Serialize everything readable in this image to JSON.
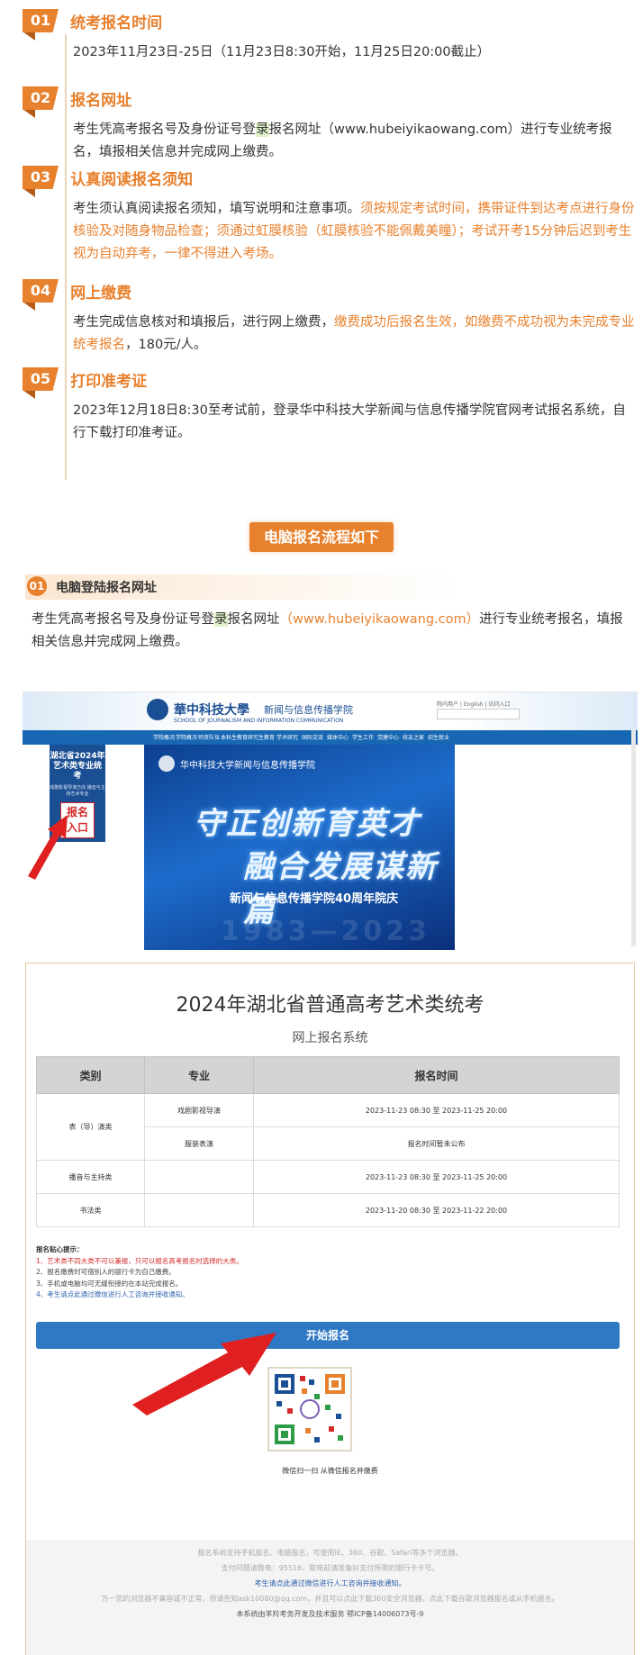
{
  "steps": [
    {
      "num": "01",
      "title": "统考报名时间",
      "body": "2023年11月23日-25日（11月23日8:30开始，11月25日20:00截止）"
    },
    {
      "num": "02",
      "title": "报名网址",
      "body_a": "考生凭高考报名号及身份证号登",
      "body_hl": "录",
      "body_b": "报名网址（www.hubeiyikaowang.com）进行专业统考报名，填报相关信息并完成网上缴费。"
    },
    {
      "num": "03",
      "title": "认真阅读报名须知",
      "body_a": "考生须认真阅读报名须知，填写说明和注意事项。",
      "body_orange": "须按规定考试时间，携带证件到达考点进行身份核验及对随身物品检查；须通过虹膜核验（虹膜核验不能佩戴美瞳）；考试开考15分钟后迟到考生视为自动弃考，一律不得进入考场。"
    },
    {
      "num": "04",
      "title": "网上缴费",
      "body_a": "考生完成信息核对和填报后，进行网上缴费，",
      "body_orange": "缴费成功后报名生效，如缴费不成功视为未完成专业统考报名",
      "body_b": "，180元/人。"
    },
    {
      "num": "05",
      "title": "打印准考证",
      "body": "2023年12月18日8:30至考试前，登录华中科技大学新闻与信息传播学院官网考试报名系统，自行下载打印准考证。"
    }
  ],
  "section_banner": "电脑报名流程如下",
  "substep": {
    "num": "01",
    "title": "电脑登陆报名网址"
  },
  "substep_text": {
    "a": "考生凭高考报名号及身份证号登",
    "hl": "录",
    "b": "报名网址",
    "url": "（www.hubeiyikaowang.com）",
    "c": "进行专业统考报名，填报相关信息并完成网上缴费。"
  },
  "site": {
    "logo": "華中科技大學",
    "dept": "新闻与信息传播学院",
    "logo_en": "SCHOOL OF JOURNALISM AND INFORMATION COMMUNICATION",
    "toplinks": "院内用户 | English | 访问入口",
    "nav": [
      "学院概况",
      "学院概况",
      "师资队伍",
      "本科生教育",
      "研究生教育",
      "学术研究",
      "国际交流",
      "媒体中心",
      "学生工作",
      "党建中心",
      "校友之家",
      "招生就业"
    ],
    "hero_logo": "华中科技大学新闻与信息传播学院",
    "hero_line1": "守正创新育英才",
    "hero_line2": "融合发展谋新篇",
    "hero_sub": "新闻与信息传播学院40周年院庆",
    "hero_years": "1983—2023",
    "side_title": "湖北省2024年艺术类专业统考",
    "side_sub": "戏剧影视导演方向 播音与主持艺术专业",
    "side_btn_1": "报名",
    "side_btn_2": "入口"
  },
  "system": {
    "title": "2024年湖北省普通高考艺术类统考",
    "subtitle": "网上报名系统",
    "headers": [
      "类别",
      "专业",
      "报名时间"
    ],
    "rows": [
      {
        "category": "表（导）演类",
        "major": "戏剧影视导演",
        "time": "2023-11-23 08:30 至 2023-11-25 20:00"
      },
      {
        "major": "服装表演",
        "time": "报名时间暂未公布"
      },
      {
        "category": "播音与主持类",
        "major": "",
        "time": "2023-11-23 08:30 至 2023-11-25 20:00"
      },
      {
        "category": "书法类",
        "major": "",
        "time": "2023-11-20 08:30 至 2023-11-22 20:00"
      }
    ],
    "tips_title": "报名贴心提示：",
    "tips": [
      "1、艺术类不同大类不可以兼报，只可以报名高考报名时选择的大类。",
      "2、报名缴费时可借别人的银行卡为自己缴费。",
      "3、手机或电脑均可无缝衔接的在本站完成报名。",
      "4、考生请点此通过微信进行人工咨询并接收通知。"
    ],
    "start_button": "开始报名",
    "qr_label": "微信扫一扫 从微信报名并缴费",
    "footer": [
      "报名系统支持手机报名、电脑报名，可使用IE、360、谷歌、Safari等多个浏览器。",
      "支付问题请致电：95516，取电前请准备好支付所用的银行卡卡号。",
      "考生请点此通过微信进行人工咨询并接收通知。",
      "万一您的浏览器不兼容或不正常，烦请告知ask10080@qq.com，并且可以点此下载360安全浏览器，点此下载谷歌浏览器报名或从手机报名。",
      "本系统由羊羚考务开发及技术服务   鄂ICP备14006073号-9"
    ]
  },
  "colors": {
    "accent": "#e8812e",
    "navy": "#1b4f93",
    "link": "#2b5fad",
    "red": "#d32a2a"
  }
}
